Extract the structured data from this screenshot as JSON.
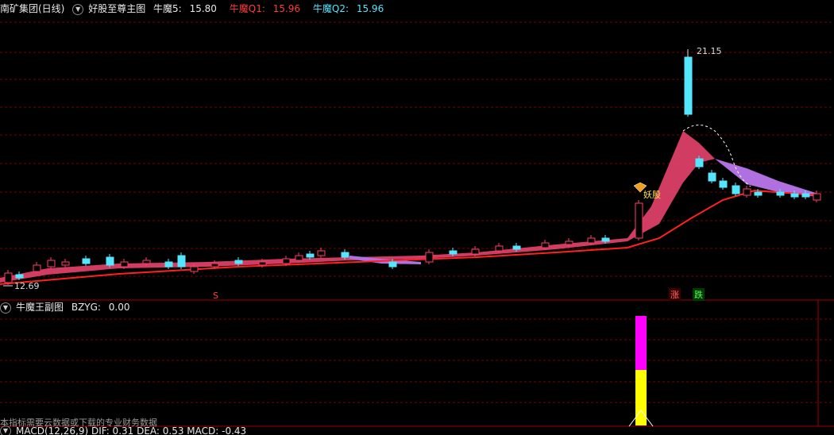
{
  "main_panel": {
    "stock_name": "南矿集团(日线)",
    "indicator_name": "好股至尊主图",
    "line5_label": "牛魔5:",
    "line5_value": "15.80",
    "q1_label": "牛魔Q1:",
    "q1_value": "15.96",
    "q2_label": "牛魔Q2:",
    "q2_value": "15.96",
    "high_label": "21.15",
    "low_label": "12.69",
    "tag_yao": "妖股",
    "tag_s": "S",
    "tag_zhang": "涨",
    "tag_die": "跌"
  },
  "sub_panel": {
    "title": "牛魔王副图",
    "bzyg_label": "BZYG:",
    "bzyg_value": "0.00",
    "note": "本指标需要云数据或下载的专业财务数据"
  },
  "macd_panel": {
    "text": "MACD(12,26,9) DIF: 0.31 DEA: 0.53 MACD: -0.43"
  },
  "colors": {
    "up": "#ff3b6b",
    "down": "#55e6ff",
    "band_pink": "#e8436e",
    "band_purple": "#b070e0",
    "ma_red": "#ff2020",
    "magenta": "#ff00ff",
    "yellow": "#ffff00",
    "grid": "#7a0000"
  }
}
